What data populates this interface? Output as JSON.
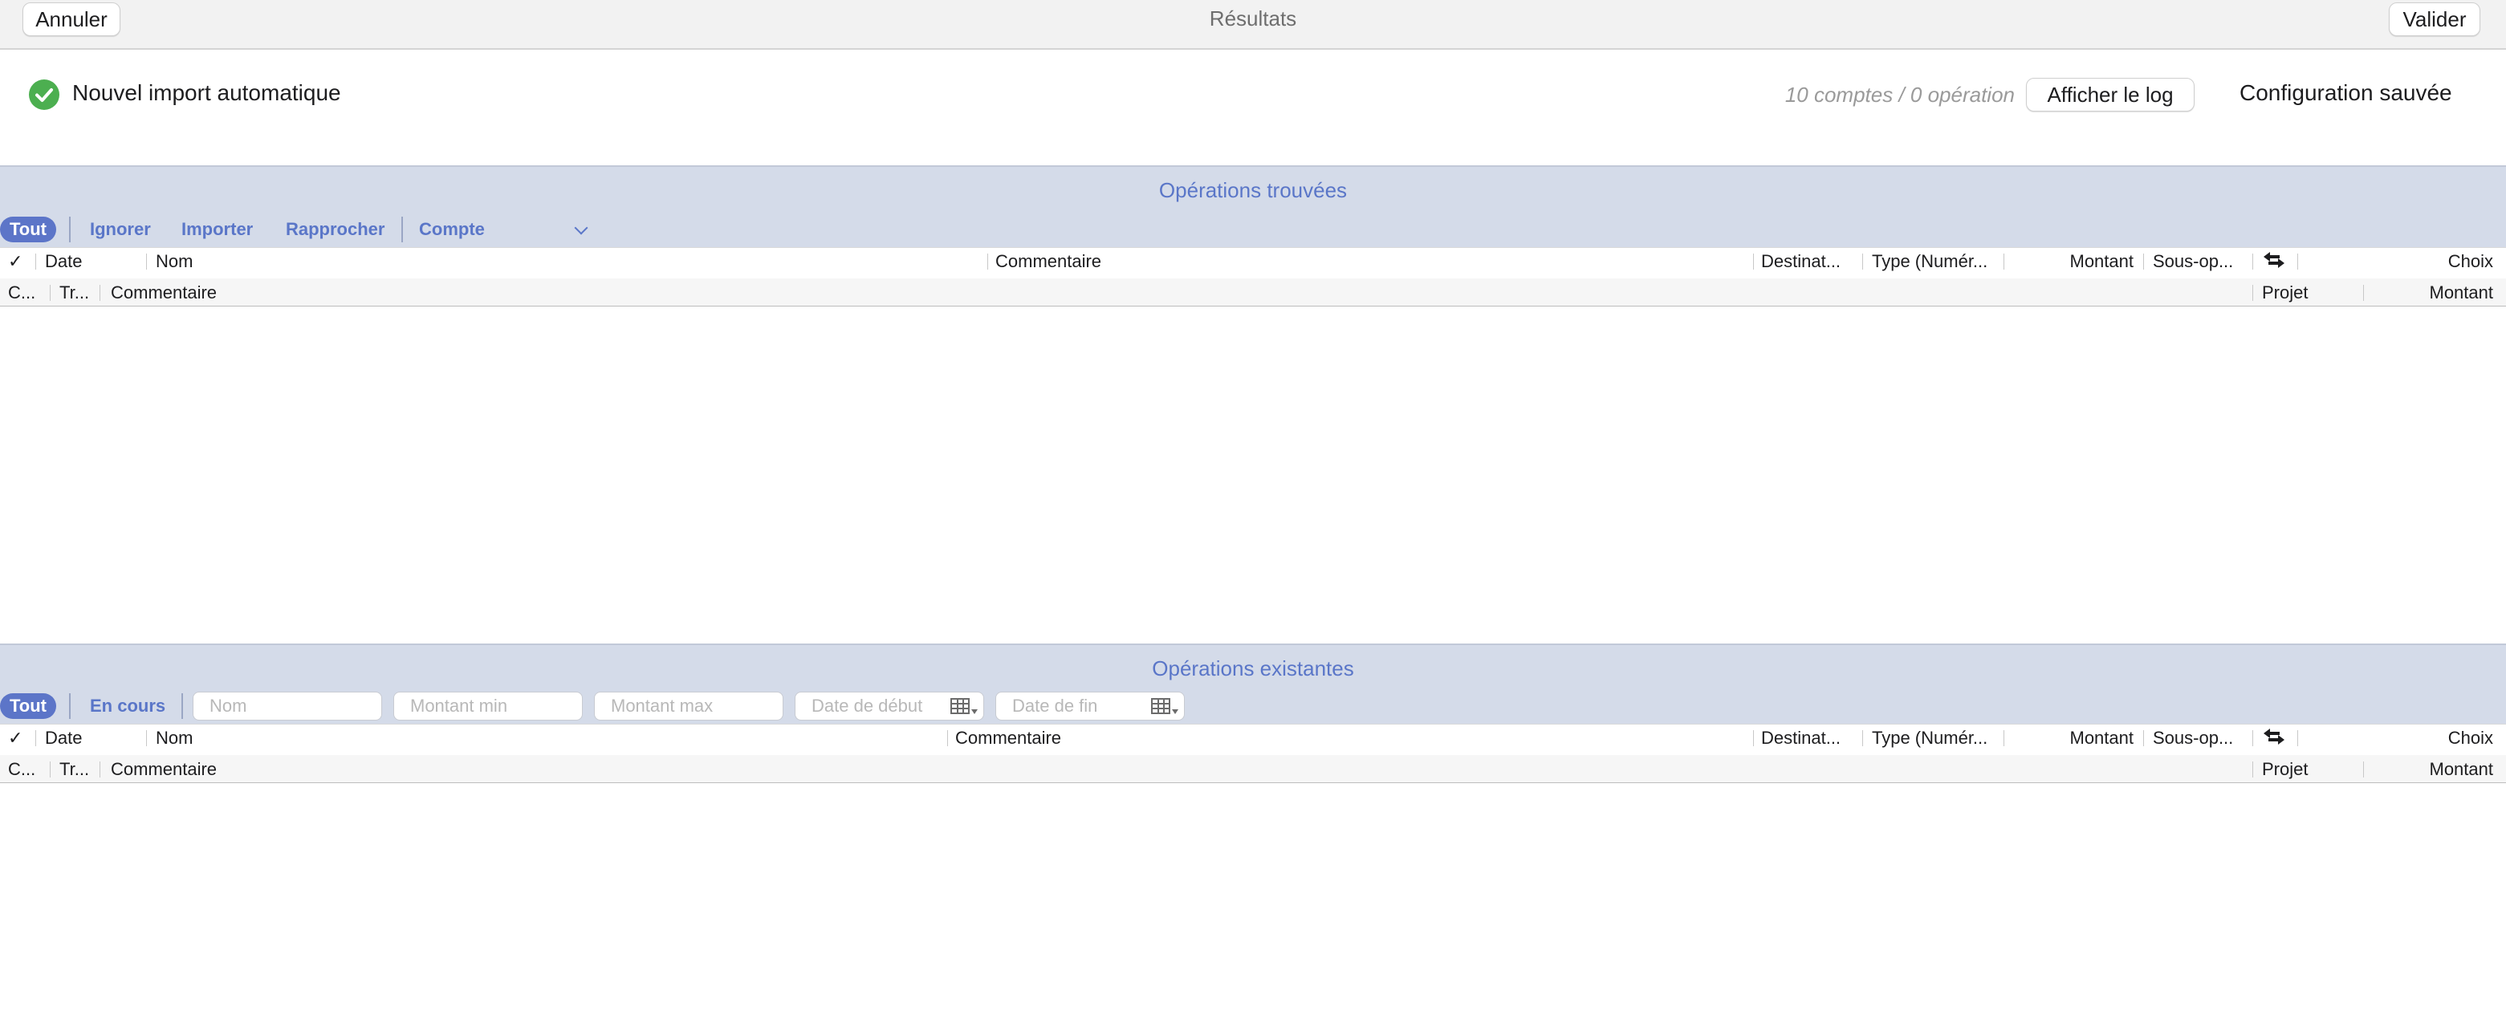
{
  "toolbar": {
    "cancel_label": "Annuler",
    "title": "Résultats",
    "validate_label": "Valider"
  },
  "import": {
    "status_title": "Nouvel import automatique",
    "count_text": "10 comptes / 0 opération",
    "show_log_label": "Afficher le log",
    "config_saved": "Configuration sauvée"
  },
  "found": {
    "title": "Opérations trouvées",
    "filters": {
      "all": "Tout",
      "ignore": "Ignorer",
      "import": "Importer",
      "reconcile": "Rapprocher",
      "account": "Compte"
    },
    "columns_row1": {
      "check": "✓",
      "date": "Date",
      "name": "Nom",
      "comment": "Commentaire",
      "destination": "Destinat...",
      "type": "Type (Numér...",
      "amount": "Montant",
      "subop": "Sous-op...",
      "choice": "Choix"
    },
    "columns_row2": {
      "c": "C...",
      "tr": "Tr...",
      "comment": "Commentaire",
      "project": "Projet",
      "amount": "Montant"
    }
  },
  "existing": {
    "title": "Opérations existantes",
    "filters": {
      "all": "Tout",
      "pending": "En cours"
    },
    "inputs": {
      "name_placeholder": "Nom",
      "min_placeholder": "Montant min",
      "max_placeholder": "Montant max",
      "start_placeholder": "Date de début",
      "end_placeholder": "Date de fin"
    },
    "columns_row1": {
      "check": "✓",
      "date": "Date",
      "name": "Nom",
      "comment": "Commentaire",
      "destination": "Destinat...",
      "type": "Type (Numér...",
      "amount": "Montant",
      "subop": "Sous-op...",
      "choice": "Choix"
    },
    "columns_row2": {
      "c": "C...",
      "tr": "Tr...",
      "comment": "Commentaire",
      "project": "Projet",
      "amount": "Montant"
    }
  },
  "colors": {
    "section_bg": "#d4dbe9",
    "accent": "#5a76c8",
    "success": "#4caf50"
  },
  "icons": {
    "status": "checkmark-circle-icon",
    "swap": "swap-arrows-icon",
    "calendar": "calendar-icon",
    "chevron": "chevron-down-icon"
  }
}
